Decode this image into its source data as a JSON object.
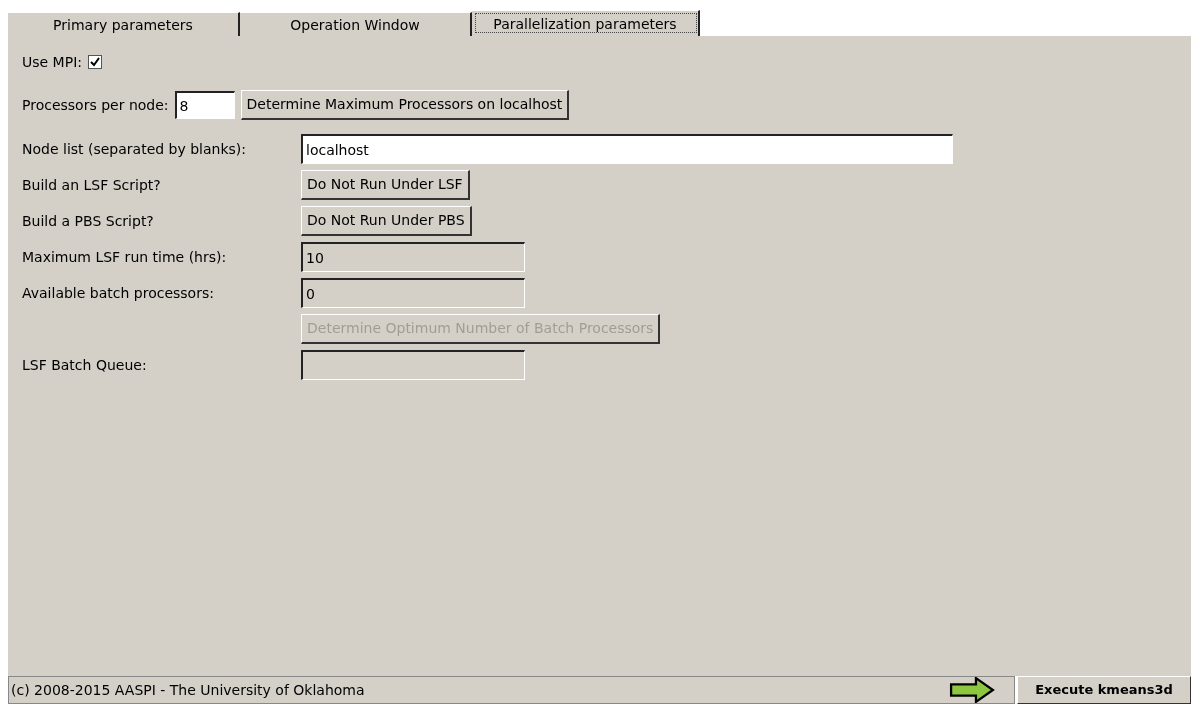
{
  "tabs": [
    {
      "label": "Primary parameters",
      "selected": false
    },
    {
      "label": "Operation Window",
      "selected": false
    },
    {
      "label": "Parallelization parameters",
      "selected": true
    }
  ],
  "use_mpi": {
    "label": "Use MPI:",
    "checked": true
  },
  "processors": {
    "label": "Processors per node:",
    "value": "8",
    "button": "Determine Maximum Processors on localhost"
  },
  "rows": [
    {
      "kind": "field",
      "label": "Node list (separated by blanks):",
      "value": "localhost",
      "disabled": false
    },
    {
      "kind": "button",
      "label": "Build an LSF Script?",
      "text": "Do Not Run Under LSF",
      "disabled": false
    },
    {
      "kind": "button",
      "label": "Build a PBS Script?",
      "text": "Do Not Run Under PBS",
      "disabled": false
    },
    {
      "kind": "field",
      "label": "Maximum LSF run time (hrs):",
      "value": "10",
      "disabled": true
    },
    {
      "kind": "field",
      "label": "Available batch processors:",
      "value": "0",
      "disabled": true
    },
    {
      "kind": "button",
      "text": "Determine Optimum Number of Batch Processors",
      "disabled": true
    },
    {
      "kind": "field",
      "label": "LSF Batch Queue:",
      "disabled": true
    }
  ],
  "status_bar": {
    "text": "(c) 2008-2015 AASPI - The University of Oklahoma",
    "execute": "Execute kmeans3d"
  }
}
